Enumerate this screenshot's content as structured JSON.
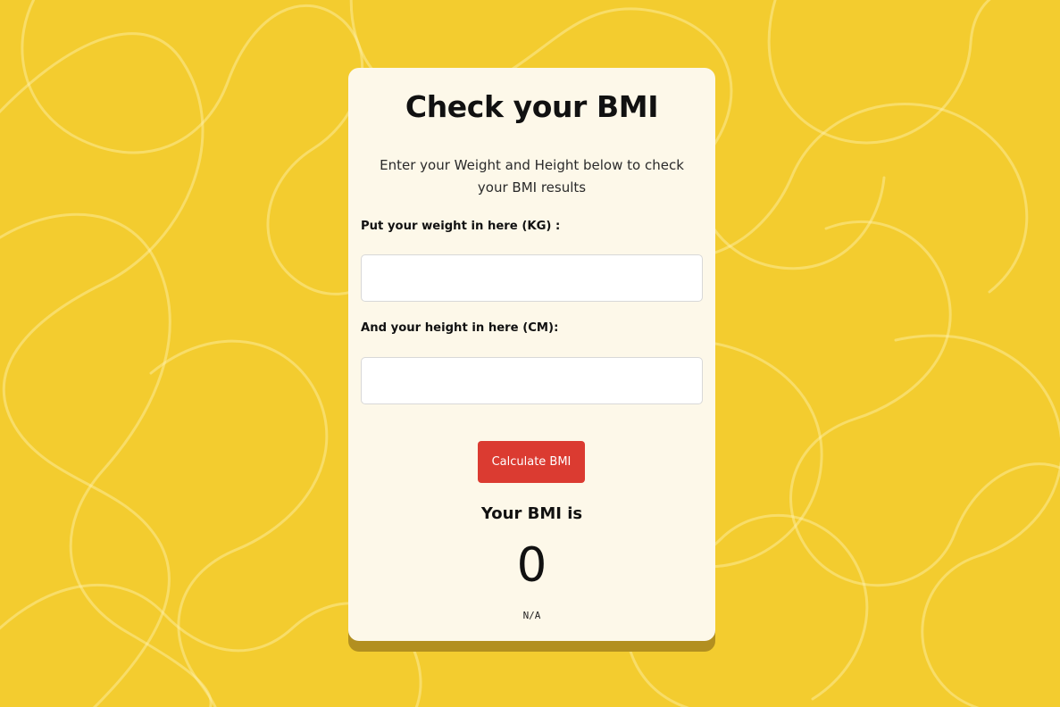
{
  "page": {
    "background_color": "#f3cc2f",
    "card_color": "#fdf8e9",
    "shadow_color": "#b28f20",
    "accent_color": "#db3b31"
  },
  "bmi_form": {
    "title": "Check your BMI",
    "subtitle": "Enter your Weight and Height below to check your BMI results",
    "weight_label": "Put your weight in here (KG) :",
    "weight_value": "",
    "weight_placeholder": "",
    "height_label": "And your height in here (CM):",
    "height_value": "",
    "height_placeholder": "",
    "calculate_label": "Calculate BMI"
  },
  "result": {
    "title": "Your BMI is",
    "value": "0",
    "status": "N/A"
  }
}
